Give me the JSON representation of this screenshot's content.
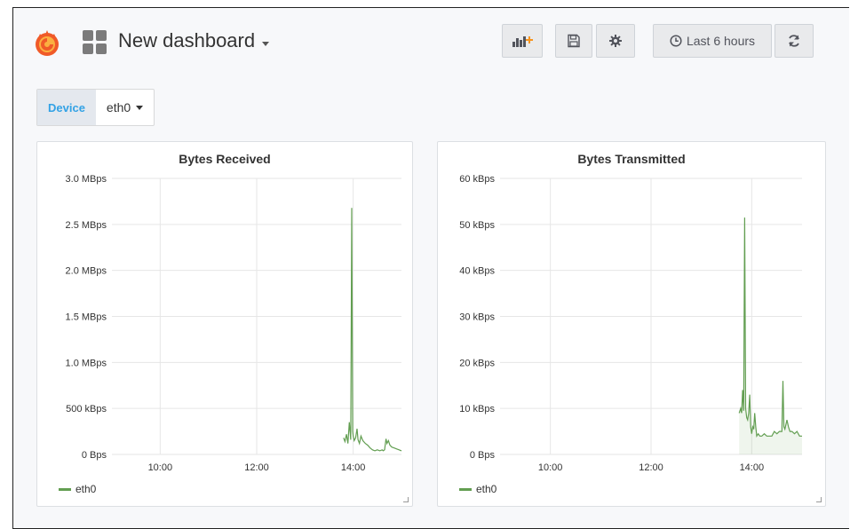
{
  "header": {
    "dashboard_title": "New dashboard",
    "time_range_label": "Last 6 hours",
    "icons": [
      "grafana-logo-icon",
      "dashboard-grid-icon",
      "add-panel-icon",
      "save-icon",
      "settings-icon",
      "clock-icon",
      "refresh-icon"
    ]
  },
  "variables": {
    "device_label": "Device",
    "device_value": "eth0"
  },
  "colors": {
    "series": "#629e51",
    "accent": "#33a2e5",
    "logo": "#f05a28"
  },
  "panels": [
    {
      "title": "Bytes Received",
      "legend": "eth0"
    },
    {
      "title": "Bytes Transmitted",
      "legend": "eth0"
    }
  ],
  "chart_data": [
    {
      "type": "line",
      "title": "Bytes Received",
      "y_unit": "MBps",
      "yticks": [
        "3.0 MBps",
        "2.5 MBps",
        "2.0 MBps",
        "1.5 MBps",
        "1.0 MBps",
        "500 kBps",
        "0 Bps"
      ],
      "xticks": [
        "10:00",
        "12:00",
        "14:00"
      ],
      "ylim": [
        0,
        3.0
      ],
      "xlim": [
        9.0,
        15.0
      ],
      "grid": true,
      "legend_position": "bottom-left",
      "series": [
        {
          "name": "eth0",
          "x": [
            13.8,
            13.83,
            13.86,
            13.89,
            13.92,
            13.95,
            13.97,
            13.99,
            14.0,
            14.02,
            14.05,
            14.08,
            14.1,
            14.13,
            14.16,
            14.2,
            14.25,
            14.3,
            14.35,
            14.4,
            14.45,
            14.5,
            14.55,
            14.6,
            14.62,
            14.65,
            14.68,
            14.7,
            14.73,
            14.76,
            14.8,
            14.85,
            14.9,
            14.95,
            15.0
          ],
          "y": [
            0.18,
            0.14,
            0.22,
            0.12,
            0.35,
            0.16,
            2.68,
            0.25,
            0.2,
            0.15,
            0.18,
            0.28,
            0.16,
            0.12,
            0.2,
            0.15,
            0.12,
            0.1,
            0.07,
            0.05,
            0.04,
            0.05,
            0.04,
            0.05,
            0.04,
            0.05,
            0.17,
            0.12,
            0.15,
            0.1,
            0.08,
            0.07,
            0.06,
            0.05,
            0.04
          ]
        }
      ]
    },
    {
      "type": "area",
      "title": "Bytes Transmitted",
      "y_unit": "kBps",
      "yticks": [
        "60 kBps",
        "50 kBps",
        "40 kBps",
        "30 kBps",
        "20 kBps",
        "10 kBps",
        "0 Bps"
      ],
      "xticks": [
        "10:00",
        "12:00",
        "14:00"
      ],
      "ylim": [
        0,
        60
      ],
      "xlim": [
        9.0,
        15.0
      ],
      "grid": true,
      "legend_position": "bottom-left",
      "series": [
        {
          "name": "eth0",
          "x": [
            13.75,
            13.78,
            13.8,
            13.82,
            13.84,
            13.86,
            13.88,
            13.9,
            13.92,
            13.94,
            13.96,
            13.98,
            14.0,
            14.02,
            14.04,
            14.06,
            14.08,
            14.1,
            14.13,
            14.16,
            14.2,
            14.25,
            14.3,
            14.35,
            14.4,
            14.45,
            14.5,
            14.55,
            14.6,
            14.62,
            14.64,
            14.66,
            14.7,
            14.73,
            14.76,
            14.8,
            14.85,
            14.9,
            14.95,
            15.0
          ],
          "y": [
            9.0,
            10.0,
            9.0,
            14.0,
            9.5,
            51.5,
            10.0,
            8.0,
            7.5,
            9.0,
            13.0,
            6.0,
            4.5,
            6.0,
            5.5,
            9.0,
            6.0,
            4.0,
            4.5,
            4.0,
            4.0,
            4.5,
            4.0,
            4.0,
            4.0,
            5.0,
            4.5,
            5.0,
            5.0,
            16.0,
            6.0,
            5.5,
            7.5,
            6.0,
            5.0,
            5.0,
            4.5,
            5.0,
            4.0,
            4.0
          ]
        }
      ]
    }
  ]
}
